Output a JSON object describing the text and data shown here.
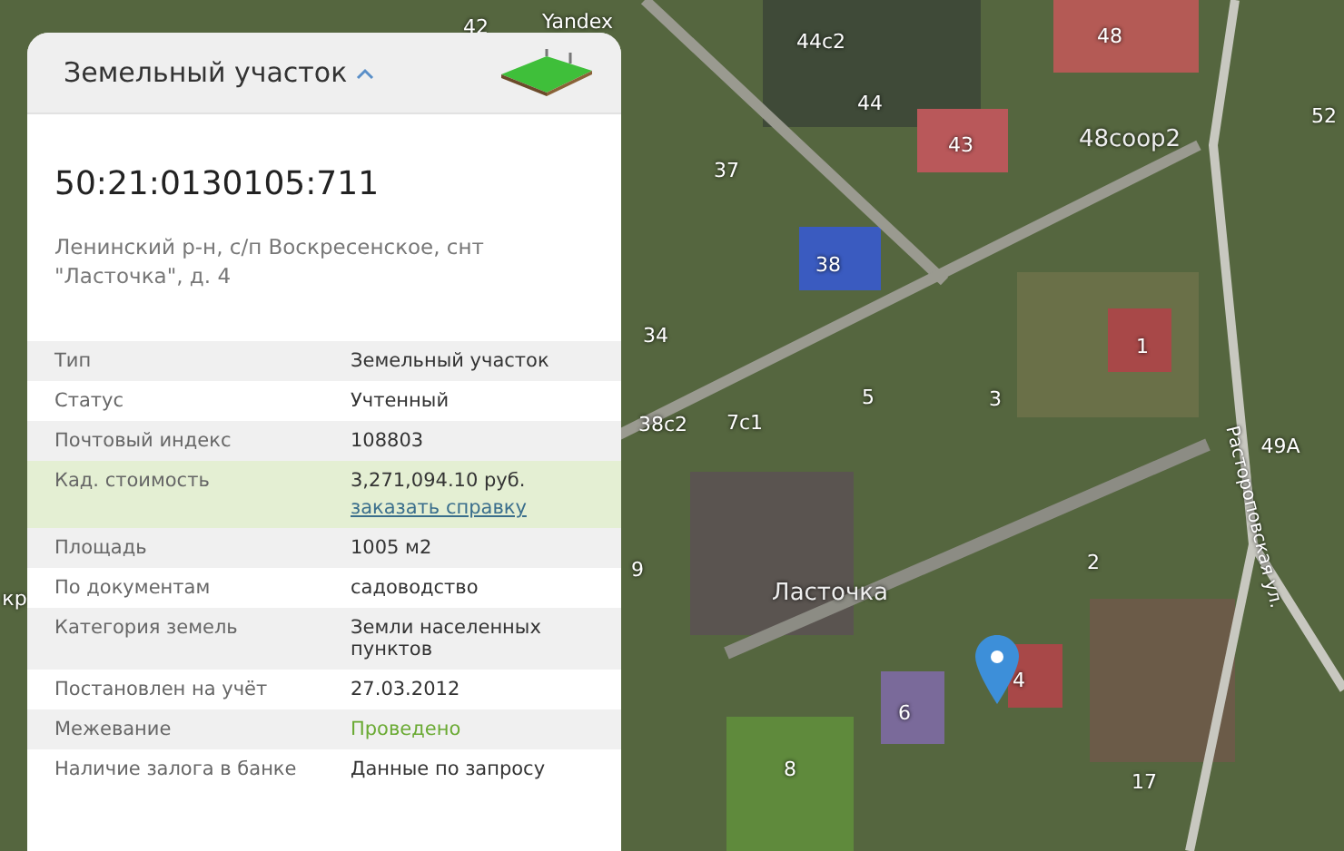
{
  "map": {
    "labels": [
      {
        "text": "42"
      },
      {
        "text": "Yandex"
      },
      {
        "text": "44с2"
      },
      {
        "text": "48"
      },
      {
        "text": "44"
      },
      {
        "text": "52"
      },
      {
        "text": "43"
      },
      {
        "text": "48соор2"
      },
      {
        "text": "37"
      },
      {
        "text": "38"
      },
      {
        "text": "34"
      },
      {
        "text": "1"
      },
      {
        "text": "5"
      },
      {
        "text": "3"
      },
      {
        "text": "38с2"
      },
      {
        "text": "7с1"
      },
      {
        "text": "49А"
      },
      {
        "text": "кр"
      },
      {
        "text": "9"
      },
      {
        "text": "2"
      },
      {
        "text": "Ласточка"
      },
      {
        "text": "4"
      },
      {
        "text": "6"
      },
      {
        "text": "8"
      },
      {
        "text": "17"
      }
    ],
    "street": "Растороповская ул."
  },
  "panel": {
    "title": "Земельный участок",
    "expanded": true,
    "number": "50:21:0130105:711",
    "address": "Ленинский р-н, с/п Воскресенское, снт \"Ласточка\", д. 4",
    "rows": [
      {
        "label": "Тип",
        "value": "Земельный участок",
        "kind": "text",
        "highlighted": false
      },
      {
        "label": "Статус",
        "value": "Учтенный",
        "kind": "text",
        "highlighted": false
      },
      {
        "label": "Почтовый индекс",
        "value": "108803",
        "kind": "text",
        "highlighted": false
      },
      {
        "label": "Кад. стоимость",
        "value": "3,271,094.10 руб.",
        "link": "заказать справку",
        "kind": "link",
        "highlighted": true
      },
      {
        "label": "Площадь",
        "value": "1005 м2",
        "kind": "text",
        "highlighted": false
      },
      {
        "label": "По документам",
        "value": "садоводство",
        "kind": "text",
        "highlighted": false
      },
      {
        "label": "Категория земель",
        "value": "Земли населенных пунктов",
        "kind": "text",
        "highlighted": false
      },
      {
        "label": "Постановлен на учёт",
        "value": "27.03.2012",
        "kind": "text",
        "highlighted": false
      },
      {
        "label": "Межевание",
        "value": "Проведено",
        "kind": "status",
        "highlighted": false
      },
      {
        "label": "Наличие залога в банке",
        "value": "Данные по запросу",
        "kind": "text",
        "highlighted": false
      }
    ]
  }
}
